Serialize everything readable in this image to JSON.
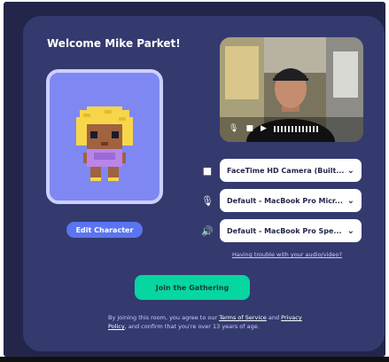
{
  "welcome_title": "Welcome Mike Parket!",
  "character": {
    "edit_label": "Edit Character",
    "card_color": "#7f88f2"
  },
  "video_preview": {
    "controls": [
      "microphone-icon",
      "camera-icon",
      "play-icon"
    ]
  },
  "devices": {
    "camera": {
      "icon": "camera-icon",
      "value": "FaceTime HD Camera (Built..."
    },
    "microphone": {
      "icon": "microphone-icon",
      "value": "Default - MacBook Pro Micr..."
    },
    "speaker": {
      "icon": "speaker-icon",
      "value": "Default - MacBook Pro Spe..."
    }
  },
  "trouble_link": "Having trouble with your audio/video?",
  "join_label": "Join the Gathering",
  "terms": {
    "prefix": "By joining this room, you agree to our ",
    "tos_link": "Terms of Service",
    "and": " and ",
    "privacy_link": "Privacy Policy",
    "suffix": ", and confirm that you're over 13 years of age."
  },
  "colors": {
    "background": "#23264a",
    "panel": "#343a6e",
    "accent_blue": "#5b74f0",
    "accent_green": "#06d6a0"
  }
}
